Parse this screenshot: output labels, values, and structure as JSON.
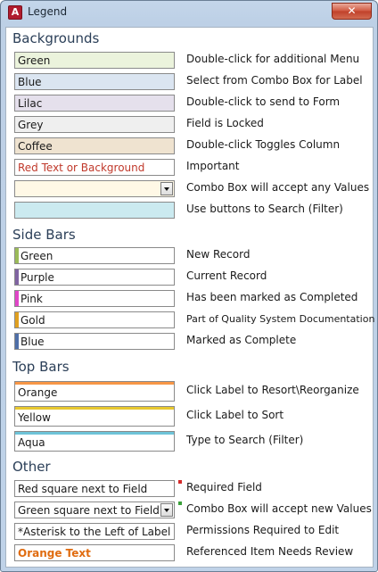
{
  "window": {
    "title": "Legend",
    "app_icon_letter": "A",
    "close_symbol": "✕"
  },
  "backgrounds": {
    "title": "Backgrounds",
    "items": [
      {
        "label": "Green",
        "desc": "Double-click for additional Menu",
        "fill": "#ebf3dc"
      },
      {
        "label": "Blue",
        "desc": "Select from Combo Box for Label",
        "fill": "#dbe5f1"
      },
      {
        "label": "Lilac",
        "desc": "Double-click to send to Form",
        "fill": "#e5e0ec"
      },
      {
        "label": "Grey",
        "desc": "Field is Locked",
        "fill": "#efefef"
      },
      {
        "label": "Coffee",
        "desc": "Double-click Toggles Column",
        "fill": "#efe3d0"
      },
      {
        "label": "Red Text or Background",
        "desc": "Important",
        "fill": "#ffffff",
        "text_color": "#c0392b"
      },
      {
        "label": "",
        "desc": "Combo Box will accept any Values",
        "fill": "#fff8e6"
      },
      {
        "label": "",
        "desc": "Use buttons to Search (Filter)",
        "fill": "#cbeaf0"
      }
    ]
  },
  "side_bars": {
    "title": "Side Bars",
    "items": [
      {
        "label": "Green",
        "desc": "New Record",
        "color": "#9bbb59"
      },
      {
        "label": "Purple",
        "desc": "Current Record",
        "color": "#8064a2"
      },
      {
        "label": "Pink",
        "desc": "Has been marked as Completed",
        "color": "#e046c8"
      },
      {
        "label": "Gold",
        "desc": "Part of Quality System Documentation",
        "color": "#e0a020"
      },
      {
        "label": "Blue",
        "desc": "Marked as Complete",
        "color": "#4f6fa8"
      }
    ]
  },
  "top_bars": {
    "title": "Top Bars",
    "items": [
      {
        "label": "Orange",
        "desc": "Click Label to Resort\\Reorganize",
        "color": "#f79646"
      },
      {
        "label": "Yellow",
        "desc": "Click Label to Sort",
        "color": "#e8c830"
      },
      {
        "label": "Aqua",
        "desc": "Type to Search (Filter)",
        "color": "#6ec3d8"
      }
    ]
  },
  "other": {
    "title": "Other",
    "items": [
      {
        "label": "Red square next to Field",
        "desc": "Required Field",
        "marker_color": "#d42a2a"
      },
      {
        "label": "Green square next to Field",
        "desc": "Combo Box will accept new Values",
        "marker_color": "#3aa03a"
      },
      {
        "label": "*Asterisk to the Left of Label",
        "desc": "Permissions Required to Edit"
      },
      {
        "label": "Orange Text",
        "desc": "Referenced Item Needs Review",
        "text_color": "#e06c10"
      }
    ]
  },
  "icons": {
    "window_icon": "access-app-icon",
    "close": "close-icon",
    "combo": "chevron-down-icon"
  }
}
